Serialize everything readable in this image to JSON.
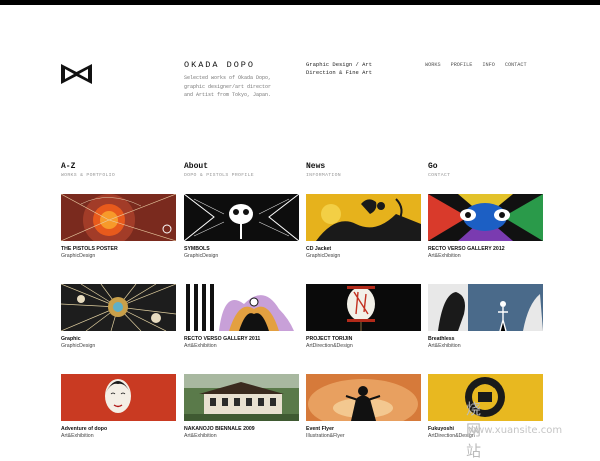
{
  "brand": {
    "title": "OKADA DOPO",
    "description": "Selected works of Okada Dopo, graphic designer/art director and Artist from Tokyo, Japan.",
    "tagline": "Graphic Design / Art Direction & Fine Art"
  },
  "nav": [
    "WORKS",
    "PROFILE",
    "INFO",
    "CONTACT"
  ],
  "sections": [
    {
      "title": "A-Z",
      "sub": "WORKS & PORTFOLIO"
    },
    {
      "title": "About",
      "sub": "DOPO & PISTOLS PROFILE"
    },
    {
      "title": "News",
      "sub": "INFORMATION"
    },
    {
      "title": "Go",
      "sub": "CONTACT"
    }
  ],
  "works": [
    {
      "title": "THE PISTOLS POSTER",
      "category": "GraphicDesign"
    },
    {
      "title": "SYMBOLS",
      "category": "GraphicDesign"
    },
    {
      "title": "CD Jacket",
      "category": "GraphicDesign"
    },
    {
      "title": "RECTO VERSO GALLERY 2012",
      "category": "Art&Exhibition"
    },
    {
      "title": "Graphic",
      "category": "GraphicDesign"
    },
    {
      "title": "RECTO VERSO GALLERY 2011",
      "category": "Art&Exhibition"
    },
    {
      "title": "PROJECT TORIJIN",
      "category": "ArtDirection&Design"
    },
    {
      "title": "Breathless",
      "category": "Art&Exhibition"
    },
    {
      "title": "Adventure of dopo",
      "category": "Art&Exhibition"
    },
    {
      "title": "NAKANOJO BIENNALE 2009",
      "category": "Art&Exhibition"
    },
    {
      "title": "Event Flyer",
      "category": "Illustration&Flyer"
    },
    {
      "title": "Fukuyoshi",
      "category": "ArtDirection&Design"
    }
  ],
  "watermark": {
    "cn": "烧网站",
    "url": "www.xuansite.com"
  },
  "colors": {
    "text": "#222222",
    "muted": "#999999",
    "topbar": "#000000"
  }
}
